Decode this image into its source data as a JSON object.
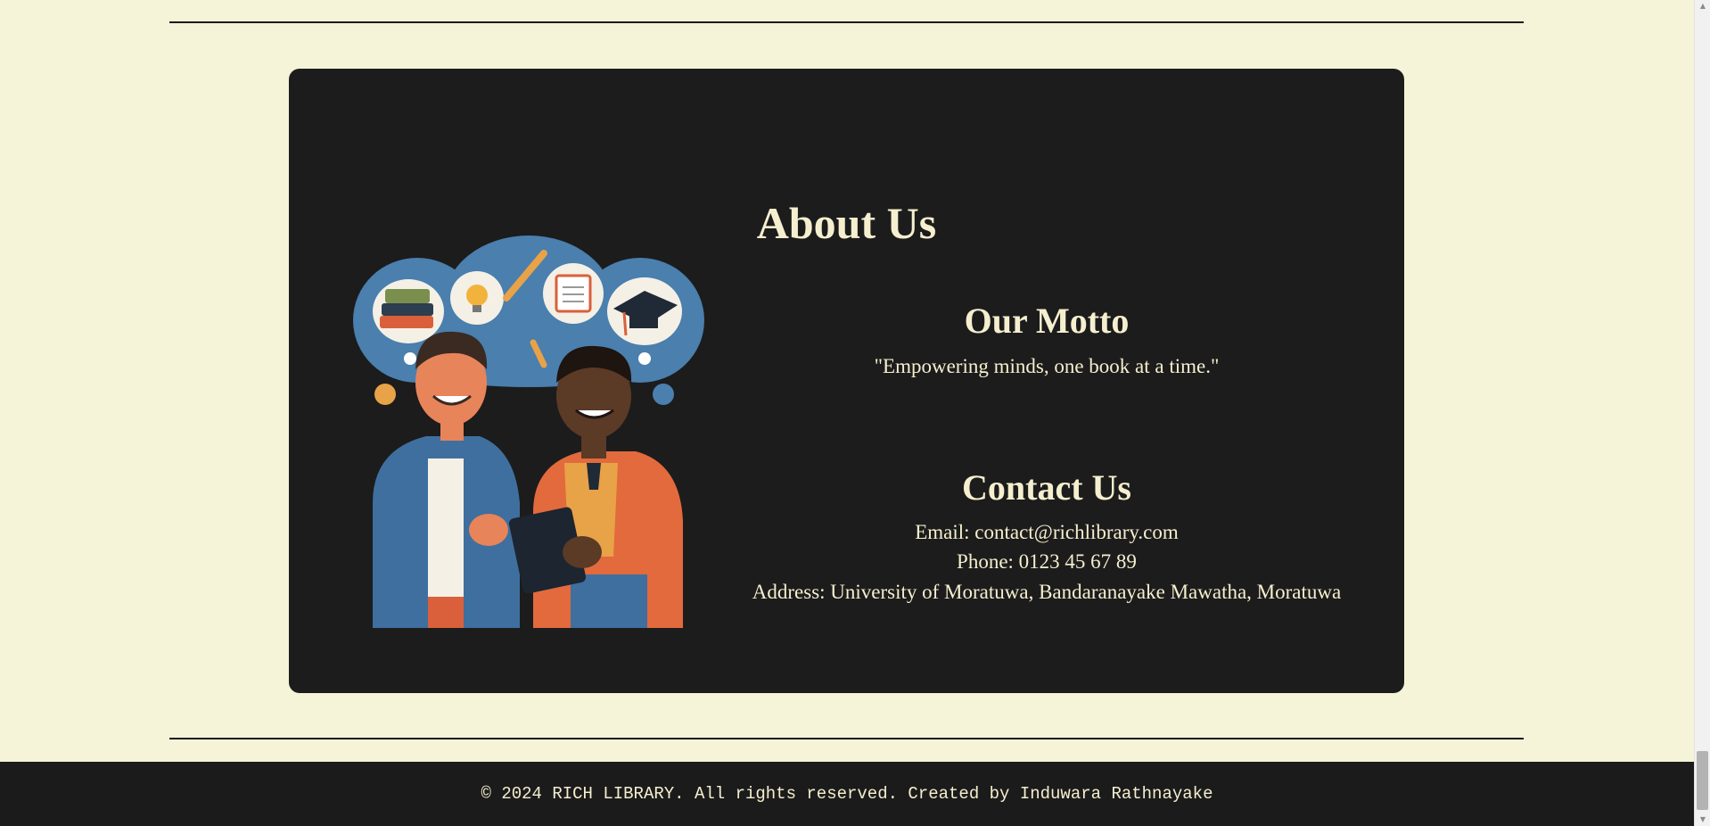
{
  "about": {
    "title": "About Us",
    "motto_heading": "Our Motto",
    "motto_text": "\"Empowering minds, one book at a time.\"",
    "contact_heading": "Contact Us",
    "email": "Email: contact@richlibrary.com",
    "phone": "Phone: 0123 45 67 89",
    "address": "Address: University of Moratuwa, Bandaranayake Mawatha, Moratuwa",
    "illustration": "two-students-sharing-tablet-illustration"
  },
  "footer": {
    "text": "© 2024 RICH LIBRARY. All rights reserved. Created by Induwara Rathnayake"
  },
  "scrollbar": {
    "up_icon": "▲",
    "down_icon": "▼"
  },
  "colors": {
    "page_background": "#f5f3d8",
    "card_background": "#1c1c1c",
    "text_cream": "#f5efcf",
    "footer_background": "#1b1b1b"
  }
}
